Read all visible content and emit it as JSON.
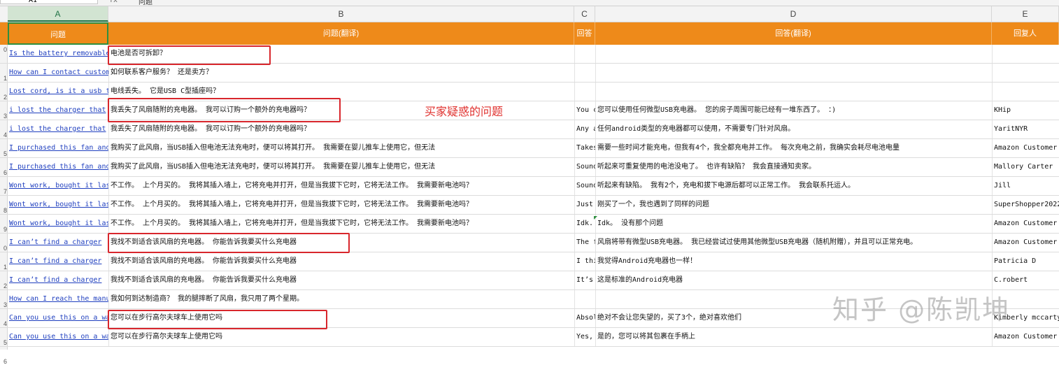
{
  "formula_bar": {
    "namebox": "A1",
    "fx": "fx",
    "value": "问题"
  },
  "columns": [
    "A",
    "B",
    "C",
    "D",
    "E"
  ],
  "header": {
    "a": "问题",
    "b": "问题(翻译)",
    "c": "回答",
    "d": "回答(翻译)",
    "e": "回复人"
  },
  "row_numbers": [
    "0",
    "1",
    "2",
    "3",
    "4",
    "5",
    "6",
    "7",
    "8",
    "9",
    "0",
    "1",
    "2",
    "3",
    "4",
    "5",
    "6"
  ],
  "rows": [
    {
      "a": "Is the battery removable",
      "b": "电池是否可拆卸？",
      "c": "",
      "d": "",
      "e": ""
    },
    {
      "a": "How can I contact customer service",
      "b": "如何联系客户服务？ 还是卖方？",
      "c": "",
      "d": "",
      "e": ""
    },
    {
      "a": "Lost cord, is it a usb type",
      "b": "电线丢失。 它是USB C型插座吗？",
      "c": "",
      "d": "",
      "e": ""
    },
    {
      "a": "i lost the charger that",
      "b": "我丢失了风扇随附的充电器。 我可以订购一个额外的充电器吗？",
      "c": "You c",
      "d": "您可以使用任何微型USB充电器。 您的房子周围可能已经有一堆东西了。  ：)",
      "e": "KHip"
    },
    {
      "a": "i lost the charger that",
      "b": "我丢失了风扇随附的充电器。 我可以订购一个额外的充电器吗？",
      "c": "Any a",
      "d": "任何android类型的充电器都可以使用，不需要专门针对风扇。",
      "e": "YaritNYR"
    },
    {
      "a": "I purchased this fan and",
      "b": "我购买了此风扇，当USB插入但电池无法充电时，便可以将其打开。 我需要在婴儿推车上使用它，但无法",
      "c": "Takes",
      "d": "需要一些时间才能充电，但我有4个，我全都充电并工作。 每次充电之前，我确实会耗尽电池电量",
      "e": "Amazon Customer"
    },
    {
      "a": "I purchased this fan and",
      "b": "我购买了此风扇，当USB插入但电池无法充电时，便可以将其打开。 我需要在婴儿推车上使用它，但无法",
      "c": "Sound",
      "d": "听起来可重复使用的电池没电了。 也许有缺陷？ 我会直接通知卖家。",
      "e": "Mallory Carter"
    },
    {
      "a": "Wont work, bought it last",
      "b": "不工作。 上个月买的。 我将其插入墙上，它将充电并打开，但是当我拔下它时，它将无法工作。 我需要新电池吗？",
      "c": "Sound",
      "d": "听起来有缺陷。 我有2个，充电和拔下电源后都可以正常工作。 我会联系托运人。",
      "e": "Jill"
    },
    {
      "a": "Wont work, bought it last",
      "b": "不工作。 上个月买的。 我将其插入墙上，它将充电并打开，但是当我拔下它时，它将无法工作。 我需要新电池吗？",
      "c": "Just",
      "d": "刚买了一个，我也遇到了同样的问题",
      "e": "SuperShopper2022"
    },
    {
      "a": "Wont work, bought it last",
      "b": "不工作。 上个月买的。 我将其插入墙上，它将充电并打开，但是当我拔下它时，它将无法工作。 我需要新电池吗？",
      "c": "Idk.",
      "d": " Idk。 没有那个问题",
      "e": "Amazon Customer"
    },
    {
      "a": "I can’t find a charger",
      "b": "我找不到适合该风扇的充电器。 你能告诉我要买什么充电器",
      "c": "The f",
      "d": "风扇将带有微型USB充电器。 我已经尝试过使用其他微型USB充电器（随机附赠），并且可以正常充电。",
      "e": "Amazon Customer"
    },
    {
      "a": "I can’t find a charger",
      "b": "我找不到适合该风扇的充电器。 你能告诉我要买什么充电器",
      "c": "I thi",
      "d": "我觉得Android充电器也一样！",
      "e": "Patricia D"
    },
    {
      "a": "I can’t find a charger",
      "b": "我找不到适合该风扇的充电器。 你能告诉我要买什么充电器",
      "c": "It’s",
      "d": "这是标准的Android充电器",
      "e": "C.robert"
    },
    {
      "a": "How can I reach the manu",
      "b": "我如何到达制造商？ 我的腿摔断了风扇，我只用了两个星期。",
      "c": "",
      "d": "",
      "e": ""
    },
    {
      "a": "Can you use this on a wa",
      "b": "您可以在步行高尔夫球车上使用它吗",
      "c": "Absol",
      "d": "绝对不会让您失望的，买了3个，绝对喜欢他们",
      "e": "Kimberly mccarty"
    },
    {
      "a": "Can you use this on a wa",
      "b": "您可以在步行高尔夫球车上使用它吗",
      "c": "Yes,",
      "d": "是的，您可以将其包裹在手柄上",
      "e": "Amazon Customer"
    }
  ],
  "annotation": "买家疑惑的问题",
  "watermark": "知乎 @陈凯坤",
  "colors": {
    "header_bg": "#ee8a1a",
    "highlight": "#d8262c",
    "annotation": "#e0322f",
    "link": "#1f3fbf"
  }
}
